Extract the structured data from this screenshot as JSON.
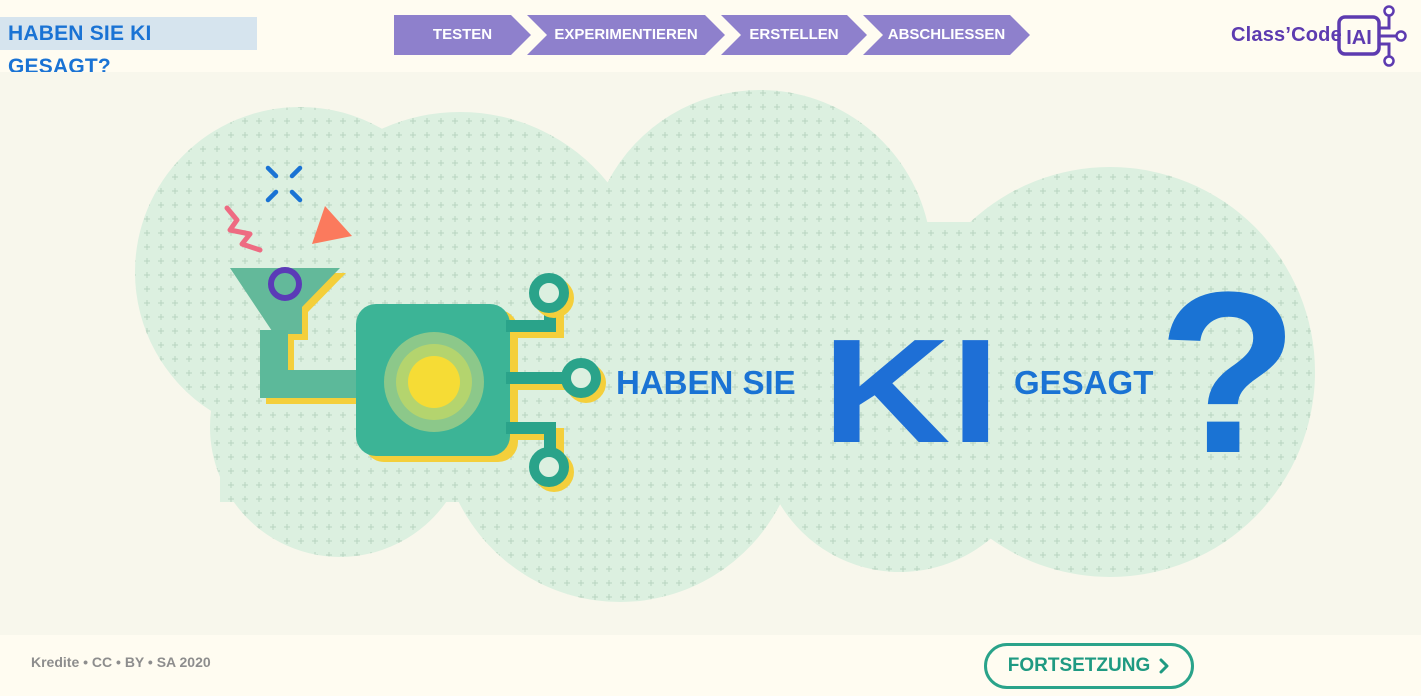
{
  "header": {
    "title": "HABEN SIE KI GESAGT?",
    "steps": [
      {
        "label": "TESTEN"
      },
      {
        "label": "EXPERIMENTIEREN"
      },
      {
        "label": "ERSTELLEN"
      },
      {
        "label": "ABSCHLIESSEN"
      }
    ],
    "logo": {
      "text": "Class’Code",
      "badge": "IAI"
    }
  },
  "hero": {
    "line_left": "HABEN SIE",
    "line_big": "KI",
    "line_right": "GESAGT",
    "question_mark": "?"
  },
  "footer": {
    "credits": "Kredite • CC • BY • SA 2020",
    "continue_label": "FORTSETZUNG",
    "continue_icon": "chevron-right-icon"
  },
  "colors": {
    "accent_purple": "#8e80cc",
    "brand_blue": "#1a73d4",
    "teal": "#2aa38a",
    "cloud": "#dcf0e0"
  }
}
